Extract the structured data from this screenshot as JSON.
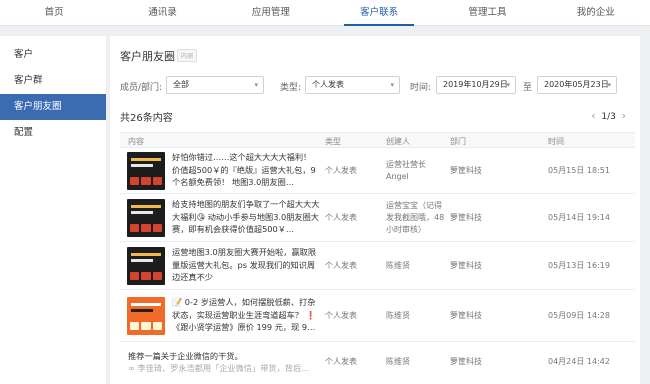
{
  "nav": {
    "tabs": [
      {
        "label": "首页"
      },
      {
        "label": "通讯录"
      },
      {
        "label": "应用管理"
      },
      {
        "label": "客户联系"
      },
      {
        "label": "管理工具"
      },
      {
        "label": "我的企业"
      }
    ],
    "active_index": 3
  },
  "sidebar": {
    "items": [
      {
        "label": "客户"
      },
      {
        "label": "客户群"
      },
      {
        "label": "客户朋友圈"
      },
      {
        "label": "配置"
      }
    ],
    "active_index": 2
  },
  "main": {
    "title": "客户朋友圈",
    "badge": "内测",
    "filters": {
      "member_label": "成员/部门:",
      "member_value": "全部",
      "type_label": "类型:",
      "type_value": "个人发表",
      "time_label": "时间:",
      "start_date": "2019年10月29日",
      "to_label": "至",
      "end_date": "2020年05月23日"
    },
    "count": "共26条内容",
    "pager": {
      "prev": "‹",
      "page": "1/3",
      "next": "›"
    },
    "columns": [
      "内容",
      "类型",
      "创建人",
      "部门",
      "时间"
    ],
    "rows": [
      {
        "text": "好怕你错过……这个超大大大大福利！ 价值超500￥的『绝版』运营大礼包，9个名额免费领！ 地图3.0朋友圈…",
        "type": "个人发表",
        "creator": "运营社营长 Angel",
        "dept": "箩筐科技",
        "time": "05月15日 18:51"
      },
      {
        "text": "给支持地图的朋友们争取了一个超大大大大福利😘 动动小手参与地图3.0朋友圈大赛，即有机会获得价值超500￥…",
        "type": "个人发表",
        "creator": "运营宝宝（记得发我截图哦，48小时审核）",
        "dept": "箩筐科技",
        "time": "05月14日 19:14"
      },
      {
        "text": "运营地图3.0朋友圈大赛开始啦，赢取限量版运营大礼包。ps 发现我们的知识周边还真不少",
        "type": "个人发表",
        "creator": "陈维贤",
        "dept": "箩筐科技",
        "time": "05月13日 16:19"
      },
      {
        "text": "📝 0-2 岁运营人，如何摆脱低薪、打杂状态，实现运营职业生涯弯道超车？ ❗《跟小贤学运营》原价 199 元，现 9…",
        "type": "个人发表",
        "creator": "陈维贤",
        "dept": "箩筐科技",
        "time": "05月09日 14:28"
      },
      {
        "text": "推荐一篇关于企业微信的干货。",
        "sub": "∞ 李佳琦、罗永浩都用「企业微信」带货，背后…",
        "type": "个人发表",
        "creator": "陈维贤",
        "dept": "箩筐科技",
        "time": "04月24日 14:42"
      }
    ]
  },
  "colors": {
    "accent": "#1f5fa8",
    "sidebar_active": "#3b6cb2"
  }
}
